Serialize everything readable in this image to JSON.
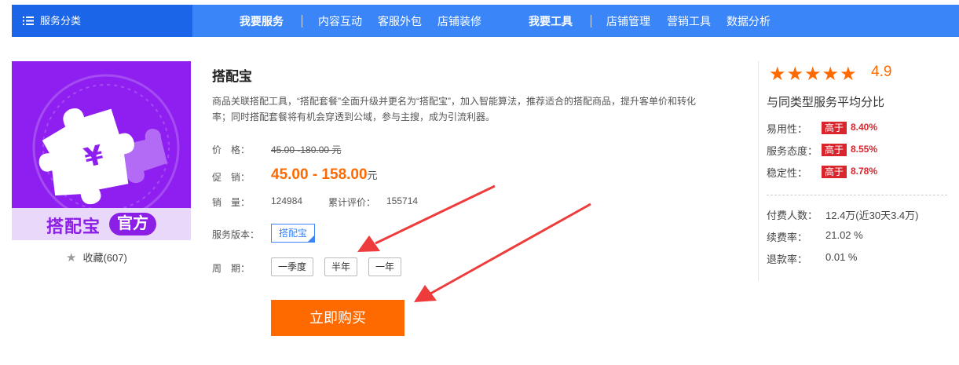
{
  "nav": {
    "category_label": "服务分类",
    "links": [
      {
        "label": "我要服务",
        "strong": true
      },
      {
        "label": "内容互动",
        "strong": false
      },
      {
        "label": "客服外包",
        "strong": false
      },
      {
        "label": "店铺装修",
        "strong": false
      },
      {
        "label": "我要工具",
        "strong": true
      },
      {
        "label": "店铺管理",
        "strong": false
      },
      {
        "label": "营销工具",
        "strong": false
      },
      {
        "label": "数据分析",
        "strong": false
      }
    ]
  },
  "logo": {
    "banner_text": "搭配宝",
    "badge": "官方",
    "colors": {
      "bg": "#8f1ff0",
      "banner": "#ead8fb",
      "accent": "#8b1fe6"
    }
  },
  "favorite": {
    "label": "收藏(607)",
    "icon": "star-icon"
  },
  "product": {
    "title": "搭配宝",
    "description": "商品关联搭配工具，“搭配套餐”全面升级并更名为“搭配宝”，加入智能算法，推荐适合的搭配商品，提升客单价和转化率；同时搭配套餐将有机会穿透到公域，参与主搜，成为引流利器。",
    "price_label": "价　格：",
    "original_price": "45.00 -180.00 元",
    "promo_label": "促　销：",
    "promo_price": "45.00 - 158.00",
    "promo_unit": "元",
    "sales_label": "销　量：",
    "sales_value": "124984",
    "reviews_label": "累计评价：",
    "reviews_value": "155714",
    "version_label": "服务版本：",
    "version_value": "搭配宝",
    "period_label": "周　期：",
    "periods": [
      "一季度",
      "半年",
      "一年"
    ],
    "buy_label": "立即购买"
  },
  "rating": {
    "stars": 5,
    "score": "4.9",
    "compare_title": "与同类型服务平均分比",
    "metrics": [
      {
        "label": "易用性：",
        "badge": "高于",
        "value": "8.40%"
      },
      {
        "label": "服务态度：",
        "badge": "高于",
        "value": "8.55%"
      },
      {
        "label": "稳定性：",
        "badge": "高于",
        "value": "8.78%"
      }
    ],
    "payment": [
      {
        "label": "付费人数：",
        "value": "12.4万(近30天3.4万)"
      },
      {
        "label": "续费率：",
        "value": "21.02 %"
      },
      {
        "label": "退款率：",
        "value": "0.01 %"
      }
    ]
  },
  "colors": {
    "nav": "#3a85f7",
    "nav_dark": "#1b66e8",
    "accent": "#ff6a00",
    "badge": "#d9262c",
    "arrow": "#ee3c3c"
  }
}
